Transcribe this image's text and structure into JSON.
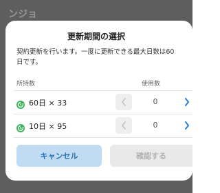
{
  "background": {
    "header_text": "ンジョ"
  },
  "dialog": {
    "title": "更新期間の選択",
    "description": "契約更新を行います。一度に更新できる最大日数は60日です。",
    "columns": {
      "owned": "所持数",
      "used": "使用数"
    },
    "items": [
      {
        "label": "60日 × 33",
        "used": "0",
        "icon": "clock-refresh-icon"
      },
      {
        "label": "10日 × 95",
        "used": "0",
        "icon": "clock-refresh-icon"
      }
    ],
    "buttons": {
      "cancel": "キャンセル",
      "confirm": "確認する"
    }
  },
  "colors": {
    "accent": "#2a7fd4",
    "icon_green": "#3bb35a",
    "cancel_bg": "#bfdcf3",
    "confirm_disabled_bg": "#e9e9e9"
  }
}
